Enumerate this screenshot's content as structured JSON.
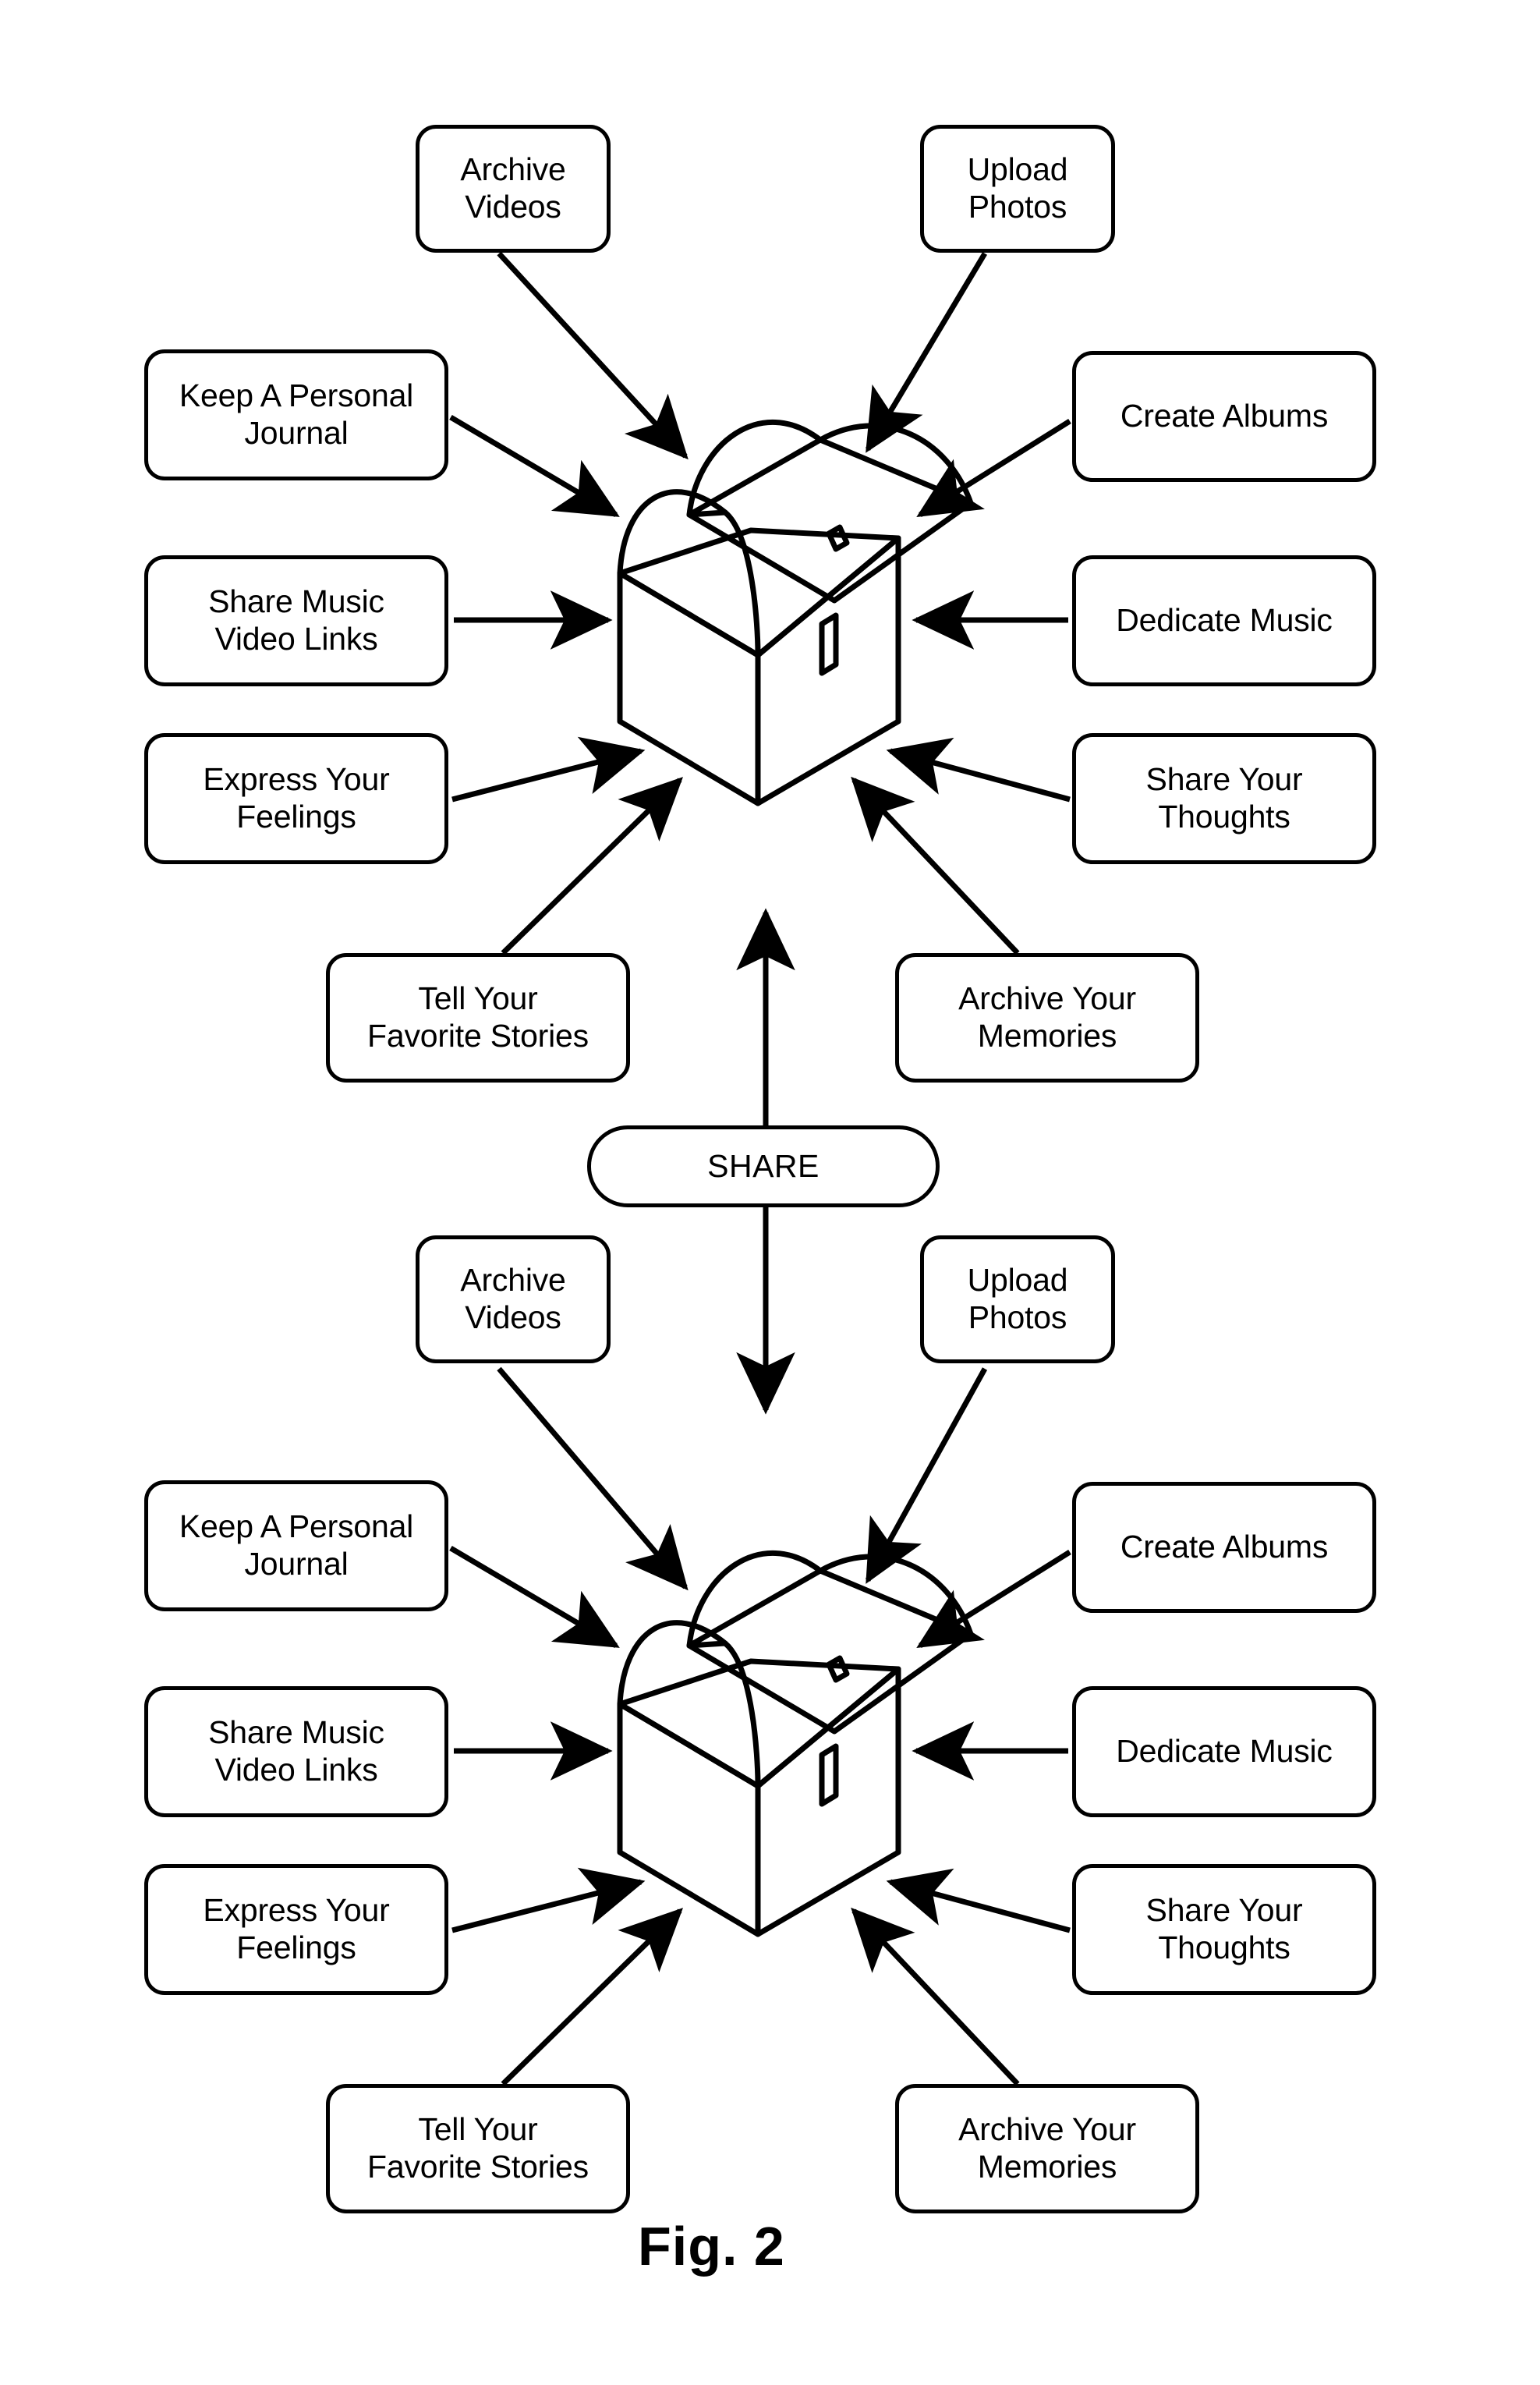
{
  "figure": {
    "caption": "Fig. 2",
    "center_icon": "treasure-chest-icon",
    "hub_label": "SHARE"
  },
  "diagrams": [
    {
      "id": "top-diagram",
      "nodes": [
        {
          "key": "archive-videos",
          "label": "Archive\nVideos"
        },
        {
          "key": "upload-photos",
          "label": "Upload\nPhotos"
        },
        {
          "key": "keep-a-personal-journal",
          "label": "Keep A Personal\nJournal"
        },
        {
          "key": "create-albums",
          "label": "Create Albums"
        },
        {
          "key": "share-music-video-links",
          "label": "Share Music\nVideo Links"
        },
        {
          "key": "dedicate-music",
          "label": "Dedicate Music"
        },
        {
          "key": "express-your-feelings",
          "label": "Express Your\nFeelings"
        },
        {
          "key": "share-your-thoughts",
          "label": "Share Your\nThoughts"
        },
        {
          "key": "tell-your-favorite-stories",
          "label": "Tell Your\nFavorite Stories"
        },
        {
          "key": "archive-your-memories",
          "label": "Archive Your\nMemories"
        }
      ]
    },
    {
      "id": "bottom-diagram",
      "nodes": [
        {
          "key": "archive-videos",
          "label": "Archive\nVideos"
        },
        {
          "key": "upload-photos",
          "label": "Upload\nPhotos"
        },
        {
          "key": "keep-a-personal-journal",
          "label": "Keep A Personal\nJournal"
        },
        {
          "key": "create-albums",
          "label": "Create Albums"
        },
        {
          "key": "share-music-video-links",
          "label": "Share Music\nVideo Links"
        },
        {
          "key": "dedicate-music",
          "label": "Dedicate Music"
        },
        {
          "key": "express-your-feelings",
          "label": "Express Your\nFeelings"
        },
        {
          "key": "share-your-thoughts",
          "label": "Share Your\nThoughts"
        },
        {
          "key": "tell-your-favorite-stories",
          "label": "Tell Your\nFavorite Stories"
        },
        {
          "key": "archive-your-memories",
          "label": "Archive Your\nMemories"
        }
      ]
    }
  ],
  "colors": {
    "stroke": "#000000",
    "fill": "#ffffff"
  }
}
